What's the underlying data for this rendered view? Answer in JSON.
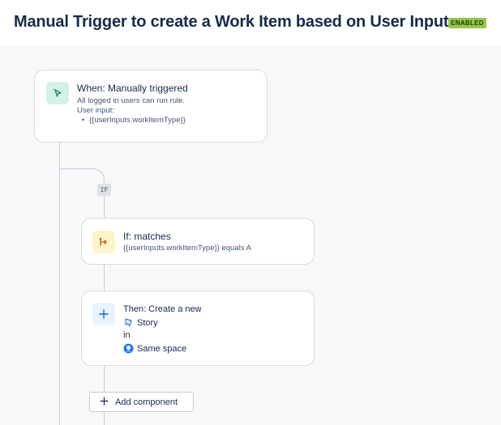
{
  "header": {
    "title": "Manual Trigger to create a Work Item based on User Input",
    "status_badge": "ENABLED"
  },
  "trigger": {
    "icon": "cursor-click-icon",
    "title": "When: Manually triggered",
    "description_line1": "All logged in users can run rule.",
    "description_line2": "User input:",
    "inputs": [
      "{{userInputs.workItemType}}"
    ]
  },
  "branch": {
    "tag": "IF"
  },
  "condition": {
    "icon": "branch-icon",
    "title": "If: matches",
    "detail": "{{userInputs.workItemType}} equals A"
  },
  "action": {
    "icon": "plus-icon",
    "title": "Then: Create a new",
    "item_type_icon": "story-bookmark-icon",
    "item_type": "Story",
    "connector": "in",
    "space_icon": "space-avatar-icon",
    "space": "Same space"
  },
  "add_component": {
    "label": "Add component",
    "icon": "plus-icon"
  },
  "colors": {
    "badge": "#94c748",
    "trigger_icon_bg": "#d3f1e5",
    "condition_icon_bg": "#fef3c7",
    "action_icon_bg": "#e9f2ff"
  }
}
